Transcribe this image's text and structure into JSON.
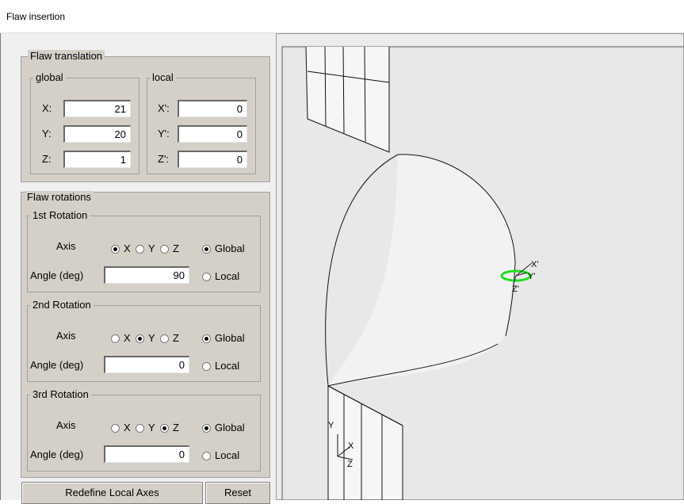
{
  "window": {
    "title": "Flaw insertion"
  },
  "translation": {
    "title": "Flaw translation",
    "global": {
      "title": "global",
      "x_label": "X:",
      "y_label": "Y:",
      "z_label": "Z:",
      "x": "21",
      "y": "20",
      "z": "1"
    },
    "local": {
      "title": "local",
      "x_label": "X':",
      "y_label": "Y':",
      "z_label": "Z':",
      "x": "0",
      "y": "0",
      "z": "0"
    }
  },
  "rotations": {
    "title": "Flaw rotations",
    "axis_label": "Axis",
    "angle_label": "Angle (deg)",
    "opt_x": "X",
    "opt_y": "Y",
    "opt_z": "Z",
    "opt_global": "Global",
    "opt_local": "Local",
    "items": [
      {
        "title": "1st Rotation",
        "axis": "X",
        "frame": "Global",
        "angle": "90"
      },
      {
        "title": "2nd Rotation",
        "axis": "Y",
        "frame": "Global",
        "angle": "0"
      },
      {
        "title": "3rd Rotation",
        "axis": "Z",
        "frame": "Global",
        "angle": "0"
      }
    ]
  },
  "buttons": {
    "redefine": "Redefine Local Axes",
    "reset": "Reset"
  },
  "viewport": {
    "flaw_axis_x": "X'",
    "flaw_axis_y": "Y'",
    "flaw_axis_z": "Z'",
    "triad_x": "X",
    "triad_y": "Y",
    "triad_z": "Z",
    "flaw_color": "#22dd22"
  }
}
